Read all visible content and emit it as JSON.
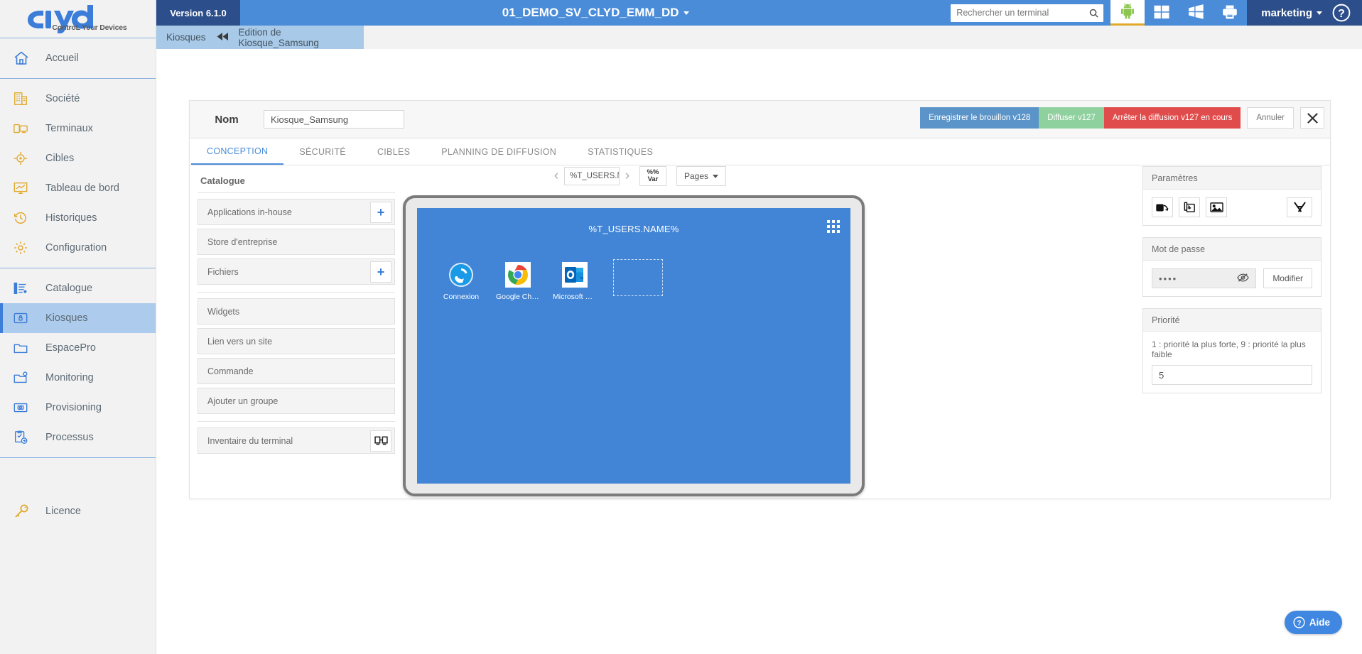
{
  "brand": {
    "name": "clyd",
    "tagline": "ControL Your Devices"
  },
  "sidebar": {
    "group1": [
      {
        "label": "Accueil",
        "icon": "home-icon"
      }
    ],
    "group2": [
      {
        "label": "Société",
        "icon": "building-icon"
      },
      {
        "label": "Terminaux",
        "icon": "devices-icon"
      },
      {
        "label": "Cibles",
        "icon": "target-icon"
      },
      {
        "label": "Tableau de bord",
        "icon": "dashboard-icon"
      },
      {
        "label": "Historiques",
        "icon": "clock-history-icon"
      },
      {
        "label": "Configuration",
        "icon": "gear-icon"
      }
    ],
    "group3": [
      {
        "label": "Catalogue",
        "icon": "catalogue-list-icon"
      },
      {
        "label": "Kiosques",
        "icon": "lock-box-icon",
        "active": true
      },
      {
        "label": "EspacePro",
        "icon": "folder-icon"
      },
      {
        "label": "Monitoring",
        "icon": "folder-gear-icon"
      },
      {
        "label": "Provisioning",
        "icon": "provisioning-icon"
      },
      {
        "label": "Processus",
        "icon": "process-icon"
      }
    ],
    "footer": {
      "label": "Licence",
      "icon": "key-icon"
    }
  },
  "topbar": {
    "version": "Version 6.1.0",
    "tenant": "01_DEMO_SV_CLYD_EMM_DD",
    "search_placeholder": "Rechercher un terminal",
    "search_value": "",
    "os_filters": [
      {
        "name": "android-icon",
        "selected": true
      },
      {
        "name": "windows-10-icon",
        "selected": false
      },
      {
        "name": "windows-legacy-icon",
        "selected": false
      },
      {
        "name": "printer-icon",
        "selected": false
      }
    ],
    "user": "marketing",
    "help": "?"
  },
  "breadcrumb": {
    "root": "Kiosques",
    "current": "Edition de Kiosque_Samsung"
  },
  "form": {
    "nom_label": "Nom",
    "nom_value": "Kiosque_Samsung",
    "actions": {
      "save_draft": "Enregistrer le brouillon v128",
      "publish": "Diffuser v127",
      "stop": "Arrêter la diffusion v127 en cours",
      "cancel": "Annuler",
      "close": "✕"
    }
  },
  "tabs": [
    {
      "label": "CONCEPTION",
      "active": true
    },
    {
      "label": "SÉCURITÉ",
      "active": false
    },
    {
      "label": "CIBLES",
      "active": false
    },
    {
      "label": "PLANNING DE DIFFUSION",
      "active": false
    },
    {
      "label": "STATISTIQUES",
      "active": false
    }
  ],
  "catalogue": {
    "title": "Catalogue",
    "block1": [
      {
        "label": "Applications in-house",
        "action": "add-icon"
      },
      {
        "label": "Store d'entreprise",
        "action": null
      },
      {
        "label": "Fichiers",
        "action": "add-icon"
      }
    ],
    "block2": [
      {
        "label": "Widgets",
        "action": null
      },
      {
        "label": "Lien vers un site",
        "action": null
      },
      {
        "label": "Commande",
        "action": null
      },
      {
        "label": "Ajouter un groupe",
        "action": null
      }
    ],
    "block3": [
      {
        "label": "Inventaire du terminal",
        "action": "inventory-icon"
      }
    ]
  },
  "preview": {
    "prev": "‹",
    "next": "›",
    "page_name": "%T_USERS.NAI",
    "var_button_line1": "%%",
    "var_button_line2": "Var",
    "pages_button": "Pages",
    "screen_title": "%T_USERS.NAME%",
    "apps": [
      {
        "label": "Connexion",
        "icon": "connexion-icon"
      },
      {
        "label": "Google Chro...",
        "icon": "chrome-icon"
      },
      {
        "label": "Microsoft Ou...",
        "icon": "outlook-icon"
      }
    ],
    "empty_slot": true
  },
  "params_panel": {
    "title": "Paramètres",
    "buttons": [
      {
        "name": "orientation-icon"
      },
      {
        "name": "add-page-icon"
      },
      {
        "name": "wallpaper-icon"
      }
    ],
    "tools_button": {
      "name": "tools-icon"
    }
  },
  "password_panel": {
    "title": "Mot de passe",
    "value": "••••",
    "reveal_icon": "eye-slash-icon",
    "modify_label": "Modifier"
  },
  "priority_panel": {
    "title": "Priorité",
    "hint": "1 : priorité la plus forte, 9 : priorité la plus faible",
    "value": "5"
  },
  "help_fab": {
    "label": "Aide"
  },
  "colors": {
    "accent_blue": "#4a8cd8",
    "dark_blue": "#2c4e8a",
    "sidebar_active": "#adcbec",
    "orange": "#e0a92c",
    "green": "#8fd19e",
    "red": "#e04b4b",
    "screen_blue": "#4285d6"
  }
}
